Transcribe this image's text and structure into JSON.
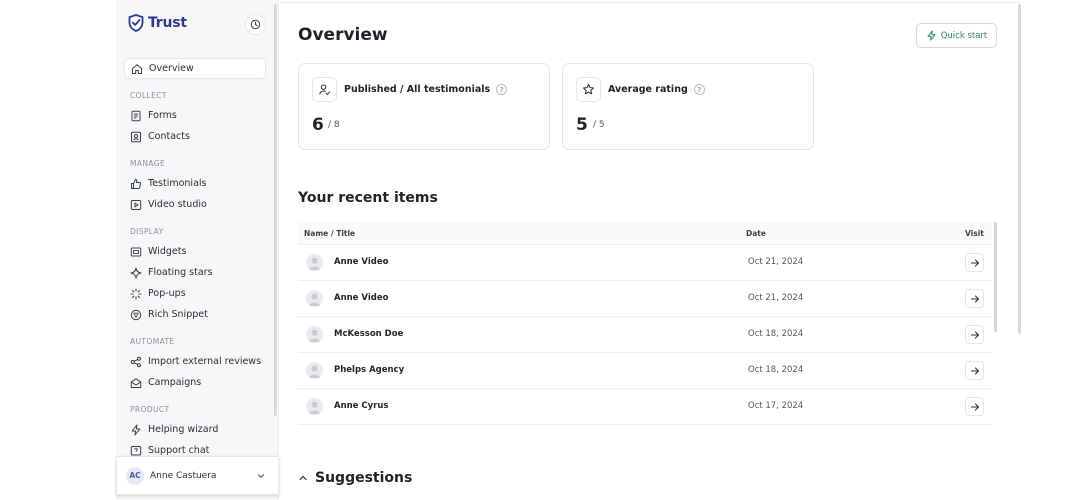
{
  "brand": {
    "name": "Trust"
  },
  "sidebar": {
    "overview": "Overview",
    "sections": {
      "collect": "COLLECT",
      "manage": "MANAGE",
      "display": "DISPLAY",
      "automate": "AUTOMATE",
      "product": "PRODUCT"
    },
    "items": {
      "forms": "Forms",
      "contacts": "Contacts",
      "testimonials": "Testimonials",
      "video_studio": "Video studio",
      "widgets": "Widgets",
      "floating_stars": "Floating stars",
      "popups": "Pop-ups",
      "rich_snippet": "Rich Snippet",
      "import_reviews": "Import external reviews",
      "campaigns": "Campaigns",
      "helping_wizard": "Helping wizard",
      "support_chat": "Support chat"
    }
  },
  "user": {
    "initials": "AC",
    "name": "Anne Castuera"
  },
  "main": {
    "title": "Overview",
    "quick_start": "Quick start",
    "stats": [
      {
        "label": "Published / All testimonials",
        "value": "6",
        "total": "/ 8",
        "help": "?"
      },
      {
        "label": "Average rating",
        "value": "5",
        "total": "/ 5",
        "help": "?"
      }
    ],
    "recent_title": "Your recent items",
    "table": {
      "headers": {
        "name": "Name / Title",
        "date": "Date",
        "visit": "Visit"
      },
      "rows": [
        {
          "name": "Anne Video",
          "date": "Oct 21, 2024"
        },
        {
          "name": "Anne Video",
          "date": "Oct 21, 2024"
        },
        {
          "name": "McKesson Doe",
          "date": "Oct 18, 2024"
        },
        {
          "name": "Phelps Agency",
          "date": "Oct 18, 2024"
        },
        {
          "name": "Anne Cyrus",
          "date": "Oct 17, 2024"
        }
      ]
    },
    "suggestions": "Suggestions"
  },
  "colors": {
    "brand": "#2a3b8f",
    "accent_green": "#2e8b4f",
    "sidebar_bg": "#f6f7f8"
  }
}
